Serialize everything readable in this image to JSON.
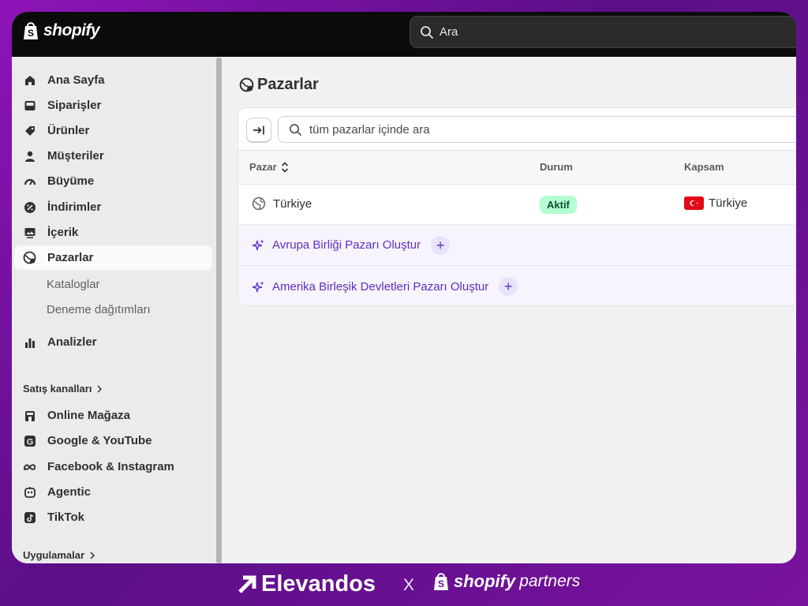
{
  "app": {
    "brand": "shopify"
  },
  "topbar": {
    "search_text": "Ara"
  },
  "sidebar": {
    "items": [
      {
        "label": "Ana Sayfa",
        "icon": "home-icon"
      },
      {
        "label": "Siparişler",
        "icon": "inbox-icon"
      },
      {
        "label": "Ürünler",
        "icon": "tag-icon"
      },
      {
        "label": "Müşteriler",
        "icon": "person-icon"
      },
      {
        "label": "Büyüme",
        "icon": "gauge-icon"
      },
      {
        "label": "İndirimler",
        "icon": "discount-icon"
      },
      {
        "label": "İçerik",
        "icon": "image-icon"
      },
      {
        "label": "Pazarlar",
        "icon": "globe-icon",
        "active": true
      }
    ],
    "sub_items": [
      "Kataloglar",
      "Deneme dağıtımları"
    ],
    "analytics": {
      "label": "Analizler",
      "icon": "bar-chart-icon"
    },
    "sales_channels_label": "Satış kanalları",
    "channels": [
      {
        "label": "Online Mağaza",
        "icon": "store-icon"
      },
      {
        "label": "Google & YouTube",
        "icon": "google-icon"
      },
      {
        "label": "Facebook & Instagram",
        "icon": "meta-icon"
      },
      {
        "label": "Agentic",
        "icon": "agentic-icon"
      },
      {
        "label": "TikTok",
        "icon": "tiktok-icon"
      }
    ],
    "apps_label": "Uygulamalar"
  },
  "main": {
    "title": "Pazarlar",
    "search_placeholder": "tüm pazarlar içinde ara",
    "columns": {
      "market": "Pazar",
      "status": "Durum",
      "scope": "Kapsam"
    },
    "rows": [
      {
        "market": "Türkiye",
        "status": "Aktif",
        "scope": "Türkiye"
      }
    ],
    "suggestions": [
      "Avrupa Birliği Pazarı Oluştur",
      "Amerika Birleşik Devletleri Pazarı Oluştur"
    ]
  },
  "footer": {
    "brand": "Elevandos",
    "separator": "X",
    "partner_brand": "shopify",
    "partner_suffix": "partners"
  },
  "colors": {
    "background": "#7a129f",
    "topbar": "#0b0b0b",
    "accent_purple": "#5e2fc4",
    "badge_bg": "#b4fed2",
    "badge_text": "#0c5132",
    "flag_red": "#e30a17"
  }
}
